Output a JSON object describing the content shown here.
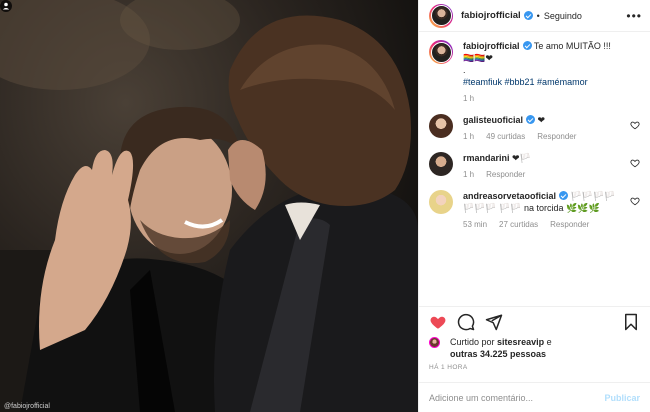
{
  "header": {
    "username": "fabiojrofficial",
    "separator": "•",
    "follow_status": "Seguindo",
    "more": "•••"
  },
  "caption": {
    "username": "fabiojrofficial",
    "text": "Te amo MUITÃO !!! 🏳️‍🌈🏳️‍🌈❤",
    "dot": ".",
    "hashtags": "#teamfiuk #bbb21 #amémamor",
    "time": "1 h"
  },
  "comments": [
    {
      "username": "galisteuoficial",
      "text": "❤",
      "time": "1 h",
      "likes": "49 curtidas",
      "reply": "Responder"
    },
    {
      "username": "rmandarini",
      "text": "❤🏳️",
      "time": "1 h",
      "likes": "",
      "reply": "Responder"
    },
    {
      "username": "andreasorvetaooficial",
      "text": "🏳️🏳️🏳️🏳️🏳️🏳️🏳️ 🏳️🏳️ na torcida 🌿🌿🌿",
      "time": "53 min",
      "likes": "27 curtidas",
      "reply": "Responder"
    }
  ],
  "likes_summary": {
    "prefix": "Curtido por",
    "user": "sitesreavip",
    "middle": "e",
    "others": "outras 34.225 pessoas"
  },
  "timestamp": "HÁ 1 HORA",
  "add_comment": {
    "placeholder": "Adicione um comentário...",
    "post_label": "Publicar"
  },
  "photo": {
    "caption": "@fabiojrofficial"
  },
  "colors": {
    "heart_liked": "#ed4956",
    "link": "#00376b",
    "verified": "#3897f0",
    "muted": "#8e8e8e"
  }
}
